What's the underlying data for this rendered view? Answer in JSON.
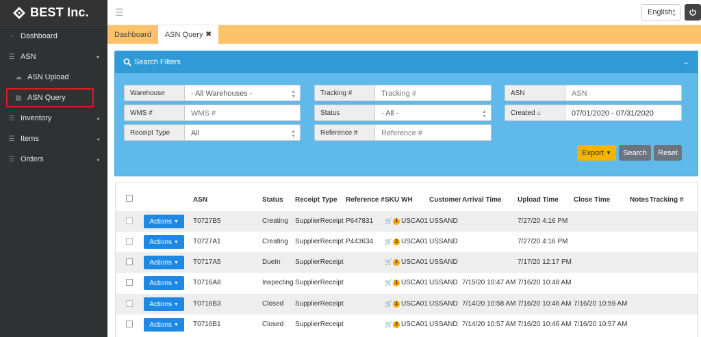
{
  "brand": {
    "name": "BEST Inc."
  },
  "sidebar": {
    "items": [
      {
        "label": "Dashboard",
        "icon": "dashboard-icon"
      },
      {
        "label": "ASN",
        "icon": "list-icon"
      },
      {
        "label": "ASN Upload",
        "icon": "cloud-upload-icon"
      },
      {
        "label": "ASN Query",
        "icon": "grid-icon"
      },
      {
        "label": "Inventory",
        "icon": "list-icon"
      },
      {
        "label": "Items",
        "icon": "list-icon"
      },
      {
        "label": "Orders",
        "icon": "list-icon"
      }
    ]
  },
  "header": {
    "language": "English"
  },
  "tabs": [
    {
      "label": "Dashboard"
    },
    {
      "label": "ASN Query"
    }
  ],
  "filters": {
    "title": "Search Filters",
    "warehouse": {
      "label": "Warehouse",
      "value": "- All Warehouses -"
    },
    "tracking": {
      "label": "Tracking #",
      "placeholder": "Tracking #"
    },
    "asn": {
      "label": "ASN",
      "placeholder": "ASN"
    },
    "wms": {
      "label": "WMS #",
      "placeholder": "WMS #"
    },
    "status": {
      "label": "Status",
      "value": "- All -"
    },
    "created": {
      "label": "Created",
      "value": "07/01/2020 - 07/31/2020"
    },
    "receipt_type": {
      "label": "Receipt Type",
      "value": "All"
    },
    "reference": {
      "label": "Reference #",
      "placeholder": "Reference #"
    },
    "export_label": "Export",
    "search_label": "Search",
    "reset_label": "Reset"
  },
  "table": {
    "headers": {
      "asn": "ASN",
      "status": "Status",
      "receipt_type": "Receipt Type",
      "reference": "Reference #",
      "sku": "SKU",
      "wh": "WH",
      "customer": "Customer",
      "arrival": "Arrival Time",
      "upload": "Upload Time",
      "close": "Close Time",
      "notes": "Notes",
      "tracking": "Tracking #"
    },
    "actions_label": "Actions",
    "rows": [
      {
        "asn": "T0727B5",
        "status": "Creating",
        "receipt_type": "SupplierReceipt",
        "reference": "P647831",
        "sku": "1",
        "wh": "USCA01",
        "customer": "USSAND",
        "arrival": "",
        "upload": "7/27/20 4:16 PM",
        "close": ""
      },
      {
        "asn": "T0727A1",
        "status": "Creating",
        "receipt_type": "SupplierReceipt",
        "reference": "P443634",
        "sku": "2",
        "wh": "USCA01",
        "customer": "USSAND",
        "arrival": "",
        "upload": "7/27/20 4:16 PM",
        "close": ""
      },
      {
        "asn": "T0717A5",
        "status": "DueIn",
        "receipt_type": "SupplierReceipt",
        "reference": "",
        "sku": "1",
        "wh": "USCA01",
        "customer": "USSAND",
        "arrival": "",
        "upload": "7/17/20 12:17 PM",
        "close": ""
      },
      {
        "asn": "T0716A8",
        "status": "Inspecting",
        "receipt_type": "SupplierReceipt",
        "reference": "",
        "sku": "1",
        "wh": "USCA01",
        "customer": "USSAND",
        "arrival": "7/15/20 10:47 AM",
        "upload": "7/16/20 10:48 AM",
        "close": ""
      },
      {
        "asn": "T0716B3",
        "status": "Closed",
        "receipt_type": "SupplierReceipt",
        "reference": "",
        "sku": "1",
        "wh": "USCA01",
        "customer": "USSAND",
        "arrival": "7/14/20 10:58 AM",
        "upload": "7/16/20 10:46 AM",
        "close": "7/16/20 10:59 AM"
      },
      {
        "asn": "T0716B1",
        "status": "Closed",
        "receipt_type": "SupplierReceipt",
        "reference": "",
        "sku": "2",
        "wh": "USCA01",
        "customer": "USSAND",
        "arrival": "7/14/20 10:57 AM",
        "upload": "7/16/20 10:46 AM",
        "close": "7/16/20 10:57 AM"
      }
    ]
  },
  "colors": {
    "sidebar": "#2f3233",
    "tabs_bar": "#fcc36b",
    "panel": "#5fb9ea",
    "panel_head": "#2f9ad6",
    "primary": "#1e88e5",
    "export": "#f5b400"
  }
}
